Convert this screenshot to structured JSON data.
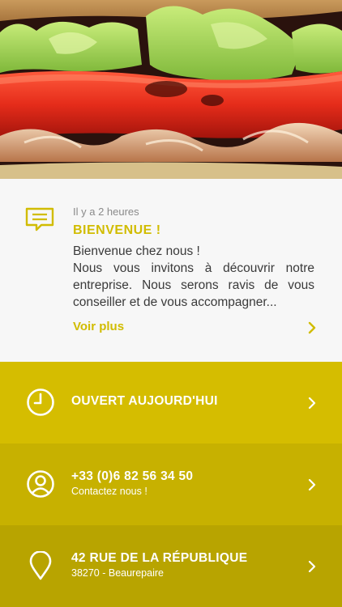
{
  "news": {
    "time": "Il y a 2 heures",
    "title": "BIENVENUE !",
    "body_lines": [
      "Bienvenue chez nous !",
      "Nous vous invitons à découvrir notre",
      "entreprise. Nous serons ravis de vous",
      "conseiller et de vous accompagner..."
    ],
    "more_label": "Voir plus",
    "icon": "message-icon"
  },
  "rows": {
    "hours": {
      "title": "OUVERT AUJOURD'HUI",
      "icon": "clock-icon"
    },
    "phone": {
      "title": "+33 (0)6 82 56 34 50",
      "subtitle": "Contactez nous !",
      "icon": "user-icon"
    },
    "address": {
      "title": "42 RUE DE LA RÉPUBLIQUE",
      "subtitle": "38270 - Beaurepaire",
      "icon": "map-pin-icon"
    }
  },
  "colors": {
    "accent": "#d1bc00",
    "row_hours": "#d5bd00",
    "row_phone": "#c7b100",
    "row_address": "#b8a400",
    "card_background": "#f7f7f7",
    "body_text": "#3a3a3a",
    "muted_text": "#8a8a8a"
  }
}
